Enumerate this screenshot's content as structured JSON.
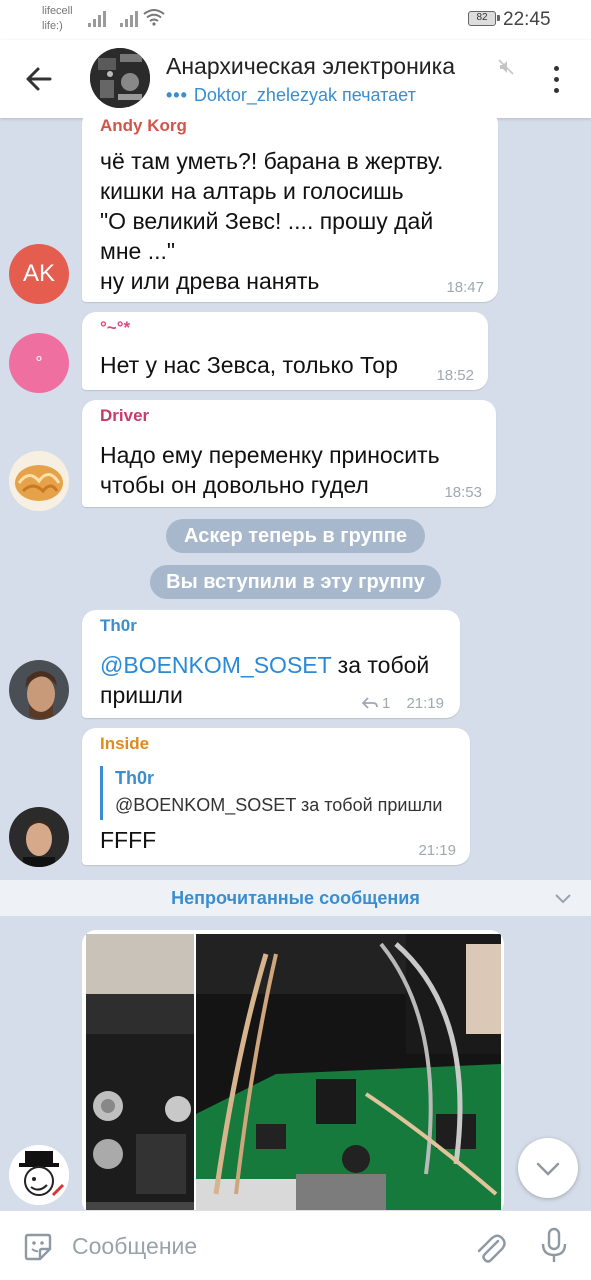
{
  "status_bar": {
    "carrier_1": "lifecell",
    "carrier_2": "life:)",
    "battery": "82",
    "time": "22:45"
  },
  "header": {
    "title": "Анархическая электроника",
    "typing_text": "Doktor_zhelezyak печатает",
    "typing_dots": "•••"
  },
  "messages": [
    {
      "sender": "Andy Korg",
      "text": "чё там уметь?! барана в жертву.\nкишки на алтарь и голосишь\n\"О великий Зевс! .... прошу дай\nмне ...\"\nну или древа нанять",
      "time": "18:47",
      "avatar_initials": "AK"
    },
    {
      "sender": "°~°*",
      "text": "Нет у нас Зевса, только Тор",
      "time": "18:52",
      "avatar_initials": "°"
    },
    {
      "sender": "Driver",
      "text": "Надо ему переменку приносить\nчтобы он довольно гудел",
      "time": "18:53"
    },
    {
      "sender": "Th0r",
      "mention": "@BOENKOM_SOSET",
      "text_after": " за тобой",
      "text_line2": "пришли",
      "replies": "1",
      "time": "21:19"
    },
    {
      "sender": "Inside",
      "reply_to_name": "Th0r",
      "reply_to_text": "@BOENKOM_SOSET за тобой пришли",
      "text": "FFFF",
      "time": "21:19"
    }
  ],
  "service_messages": [
    "Аскер теперь в группе",
    "Вы вступили в эту группу"
  ],
  "unread_label": "Непрочитанные сообщения",
  "composer": {
    "placeholder": "Сообщение"
  },
  "colors": {
    "andy": "#d2554a",
    "star": "#e0457e",
    "driver": "#c43d6a",
    "thor": "#3a8ed0",
    "inside": "#e08a1e",
    "accent": "#3a8ed0"
  }
}
